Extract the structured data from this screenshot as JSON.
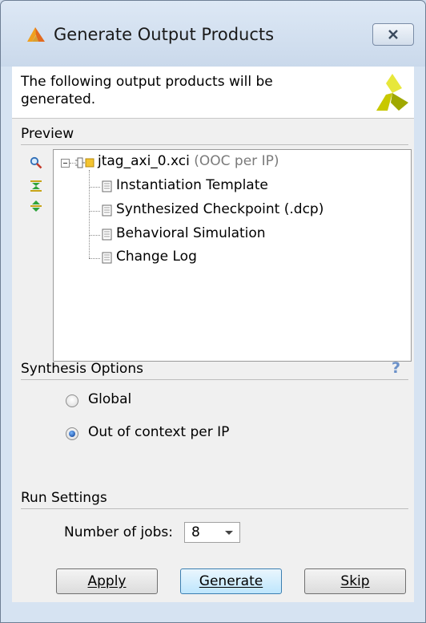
{
  "window": {
    "title": "Generate Output Products",
    "close_icon": "close-icon"
  },
  "header": {
    "message": "The following output products will be generated.",
    "logo_icon": "xilinx-logo-icon"
  },
  "preview": {
    "section_label": "Preview",
    "tools": [
      "search-icon",
      "expand-all-icon",
      "collapse-all-icon"
    ],
    "tree": {
      "root_label": "jtag_axi_0.xci",
      "root_detail": "(OOC per IP)",
      "children": [
        "Instantiation Template",
        "Synthesized Checkpoint (.dcp)",
        "Behavioral Simulation",
        "Change Log"
      ]
    }
  },
  "synthesis": {
    "section_label": "Synthesis Options",
    "help": "?",
    "options": [
      {
        "label": "Global",
        "checked": false
      },
      {
        "label": "Out of context per IP",
        "checked": true
      }
    ]
  },
  "run_settings": {
    "section_label": "Run Settings",
    "jobs_label": "Number of jobs:",
    "jobs_value": "8"
  },
  "buttons": {
    "apply": "Apply",
    "generate": "Generate",
    "skip": "Skip"
  },
  "colors": {
    "accent": "#3c7fb1",
    "logo": "#c8c800"
  }
}
